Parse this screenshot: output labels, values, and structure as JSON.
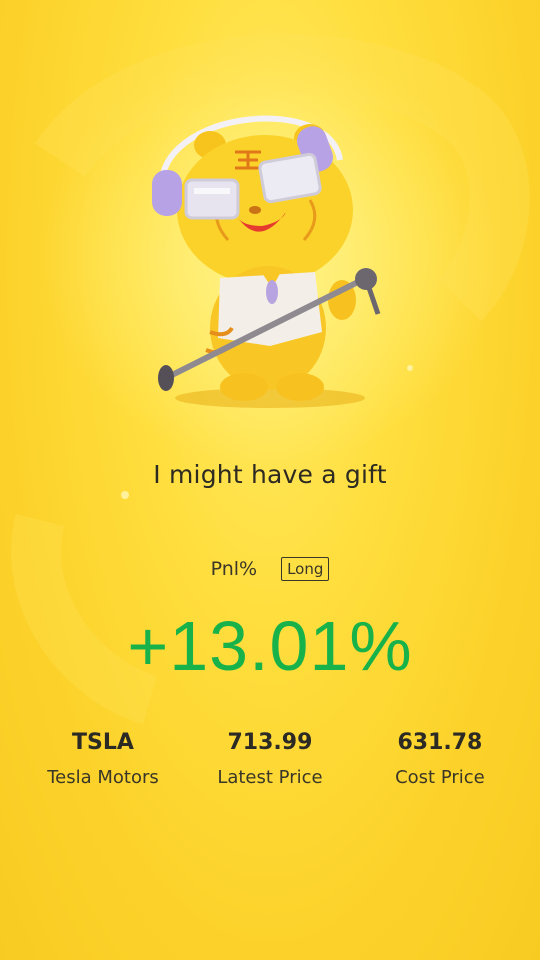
{
  "headline": "I might have a gift",
  "pnl": {
    "label": "Pnl%",
    "position_badge": "Long",
    "value": "+13.01%"
  },
  "stock": {
    "symbol": "TSLA",
    "name": "Tesla Motors",
    "latest_price": "713.99",
    "latest_price_label": "Latest Price",
    "cost_price": "631.78",
    "cost_price_label": "Cost Price"
  },
  "colors": {
    "background": "#fcd22a",
    "gain": "#18b24b",
    "text": "#2b2b2b"
  },
  "mascot": {
    "icon": "tiger-mascot-singing-icon"
  }
}
